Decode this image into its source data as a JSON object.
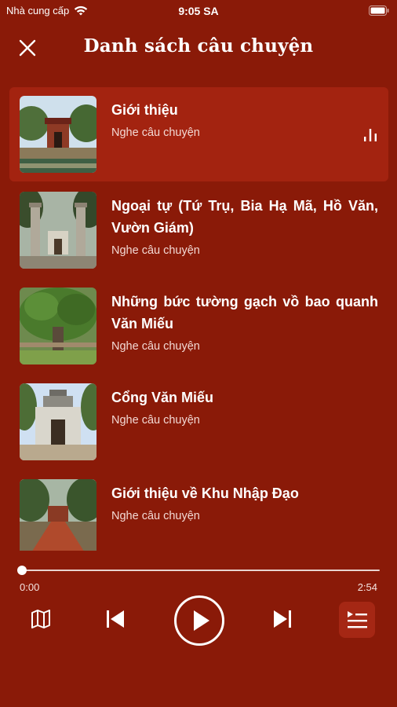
{
  "status_bar": {
    "carrier": "Nhà cung cấp",
    "time": "9:05 SA"
  },
  "header": {
    "title": "Danh sách câu chuyện"
  },
  "stories": [
    {
      "title": "Giới thiệu",
      "subtitle": "Nghe câu chuyện",
      "active": true
    },
    {
      "title": "Ngoại tự (Tứ Trụ, Bia Hạ Mã, Hồ Văn, Vườn Giám)",
      "subtitle": "Nghe câu chuyện",
      "active": false
    },
    {
      "title": "Những bức tường gạch vồ bao quanh Văn Miếu",
      "subtitle": "Nghe câu chuyện",
      "active": false
    },
    {
      "title": "Cổng Văn Miếu",
      "subtitle": "Nghe câu chuyện",
      "active": false
    },
    {
      "title": "Giới thiệu về Khu Nhập Đạo",
      "subtitle": "Nghe câu chuyện",
      "active": false
    }
  ],
  "player": {
    "elapsed": "0:00",
    "total": "2:54",
    "progress_fraction": 0.0
  },
  "colors": {
    "background": "#8a1a08",
    "active_row": "#a32310",
    "text": "#ffffff"
  },
  "icons": {
    "close": "close-icon",
    "playing": "equalizer-icon",
    "map": "map-icon",
    "previous": "skip-previous-icon",
    "play": "play-icon",
    "next": "skip-next-icon",
    "playlist": "playlist-icon",
    "wifi": "wifi-icon",
    "battery": "battery-icon"
  }
}
